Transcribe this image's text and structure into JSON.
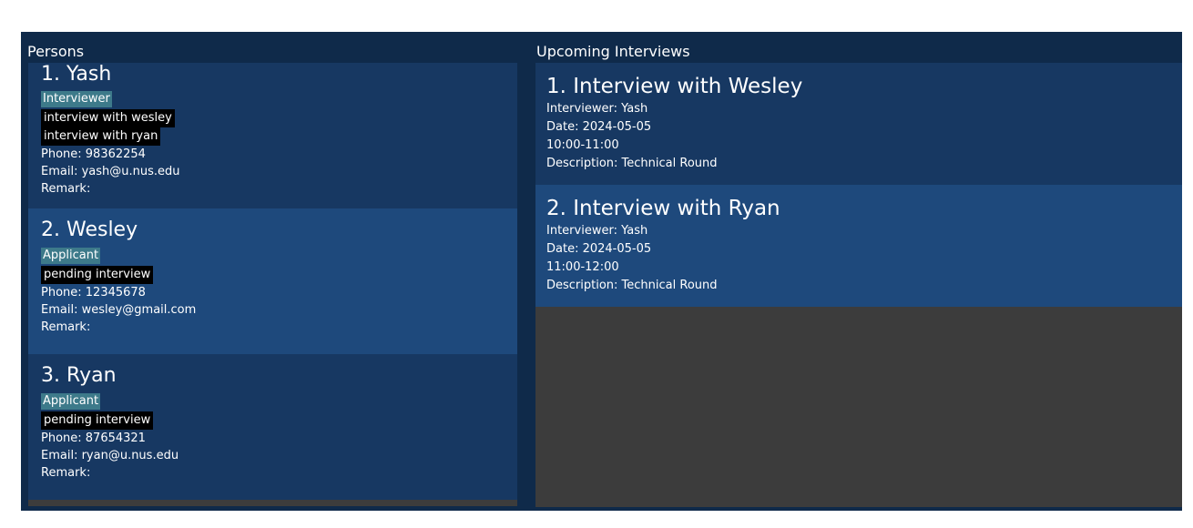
{
  "persons_pane": {
    "title": "Persons",
    "persons": [
      {
        "name": "1. Yash",
        "role": "Interviewer",
        "tags": [
          "interview with wesley",
          "interview with ryan"
        ],
        "phone": "Phone: 98362254",
        "email": "Email: yash@u.nus.edu",
        "remark": "Remark:"
      },
      {
        "name": "2. Wesley",
        "role": "Applicant",
        "tags": [
          "pending interview"
        ],
        "phone": "Phone: 12345678",
        "email": "Email: wesley@gmail.com",
        "remark": "Remark:"
      },
      {
        "name": "3. Ryan",
        "role": "Applicant",
        "tags": [
          "pending interview"
        ],
        "phone": "Phone: 87654321",
        "email": "Email: ryan@u.nus.edu",
        "remark": "Remark:"
      }
    ]
  },
  "interviews_pane": {
    "title": "Upcoming Interviews",
    "interviews": [
      {
        "title": "1. Interview with Wesley",
        "interviewer": "Interviewer: Yash",
        "date": "Date: 2024-05-05",
        "time": "10:00-11:00",
        "description": "Description: Technical Round"
      },
      {
        "title": "2. Interview with Ryan",
        "interviewer": "Interviewer: Yash",
        "date": "Date: 2024-05-05",
        "time": "11:00-12:00",
        "description": "Description: Technical Round"
      }
    ]
  },
  "colors": {
    "window_bg": "#0f2a4a",
    "card_odd": "#173862",
    "card_even": "#1e497c",
    "role_badge": "#3d7a8a",
    "tag_bg": "#000000",
    "empty_list_bg": "#3c3c3c"
  }
}
